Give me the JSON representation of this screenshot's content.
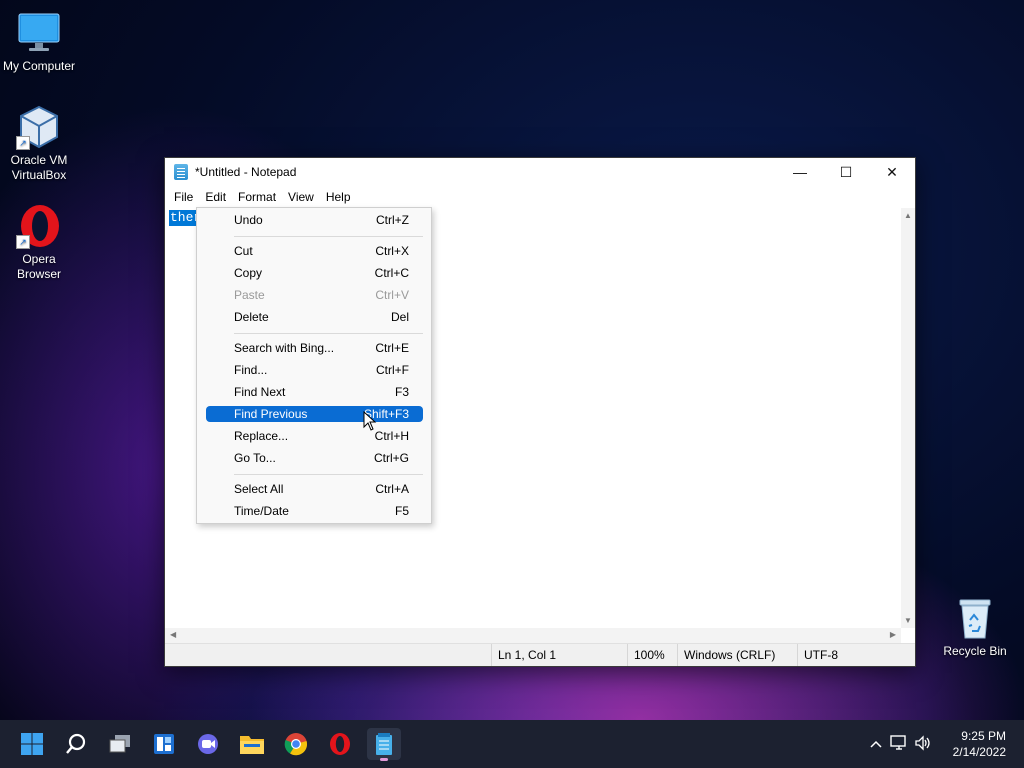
{
  "desktop": {
    "icons": [
      {
        "label_line1": "My Computer",
        "label_line2": "",
        "icon": "monitor-icon"
      },
      {
        "label_line1": "Oracle VM",
        "label_line2": "VirtualBox",
        "icon": "virtualbox-icon"
      },
      {
        "label_line1": "Opera",
        "label_line2": "Browser",
        "icon": "opera-icon"
      }
    ],
    "recycle_bin": {
      "label": "Recycle Bin",
      "icon": "recycle-bin-icon"
    }
  },
  "window": {
    "title": "*Untitled - Notepad",
    "controls": {
      "minimize": "—",
      "maximize": "☐",
      "close": "✕"
    },
    "menu": [
      "File",
      "Edit",
      "Format",
      "View",
      "Help"
    ],
    "open_menu": "Edit",
    "editor": {
      "selected_text": "ther"
    },
    "status": {
      "position": "Ln 1, Col 1",
      "zoom": "100%",
      "line_endings": "Windows (CRLF)",
      "encoding": "UTF-8"
    }
  },
  "edit_menu": {
    "items": [
      {
        "label": "Undo",
        "shortcut": "Ctrl+Z",
        "state": "enabled"
      },
      {
        "label": "Cut",
        "shortcut": "Ctrl+X",
        "state": "enabled"
      },
      {
        "label": "Copy",
        "shortcut": "Ctrl+C",
        "state": "enabled"
      },
      {
        "label": "Paste",
        "shortcut": "Ctrl+V",
        "state": "disabled"
      },
      {
        "label": "Delete",
        "shortcut": "Del",
        "state": "enabled"
      },
      {
        "label": "Search with Bing...",
        "shortcut": "Ctrl+E",
        "state": "enabled"
      },
      {
        "label": "Find...",
        "shortcut": "Ctrl+F",
        "state": "enabled"
      },
      {
        "label": "Find Next",
        "shortcut": "F3",
        "state": "enabled"
      },
      {
        "label": "Find Previous",
        "shortcut": "Shift+F3",
        "state": "highlighted"
      },
      {
        "label": "Replace...",
        "shortcut": "Ctrl+H",
        "state": "enabled"
      },
      {
        "label": "Go To...",
        "shortcut": "Ctrl+G",
        "state": "enabled"
      },
      {
        "label": "Select All",
        "shortcut": "Ctrl+A",
        "state": "enabled"
      },
      {
        "label": "Time/Date",
        "shortcut": "F5",
        "state": "enabled"
      }
    ]
  },
  "taskbar": {
    "apps": [
      "start-icon",
      "search-icon",
      "task-view-icon",
      "widgets-icon",
      "chat-icon",
      "file-explorer-icon",
      "chrome-icon",
      "opera-icon",
      "notepad-icon"
    ],
    "active_app": "notepad-icon",
    "tray_icons": [
      "chevron-up-icon",
      "network-icon",
      "volume-icon"
    ],
    "time": "9:25 PM",
    "date": "2/14/2022"
  },
  "colors": {
    "accent": "#0a6cd3",
    "selection": "#0078d7",
    "taskbar": "#1c2130"
  }
}
